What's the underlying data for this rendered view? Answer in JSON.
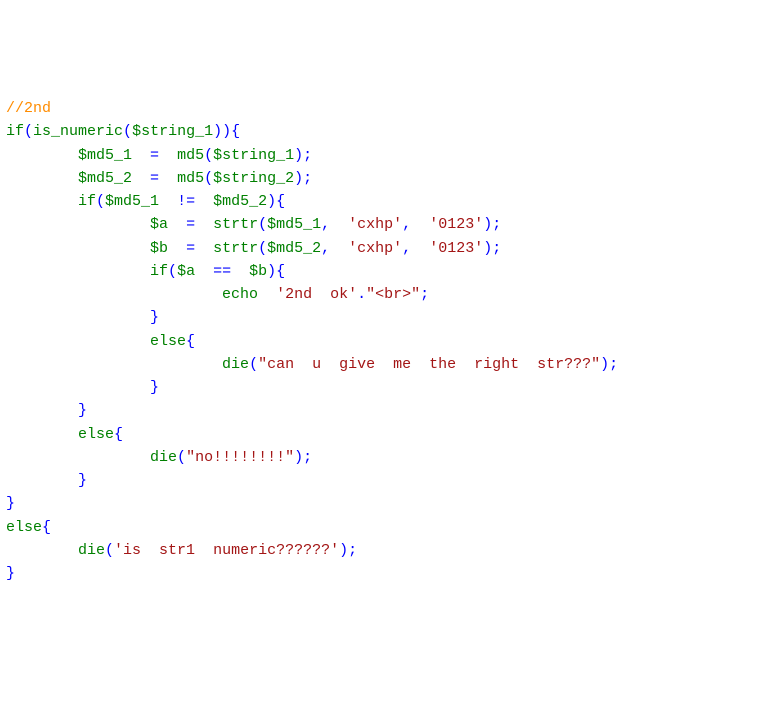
{
  "code": {
    "comment_2nd": "//2nd",
    "kw_if": "if",
    "fn_is_numeric": "is_numeric",
    "var_string_1": "$string_1",
    "var_string_2": "$string_2",
    "var_md5_1": "$md5_1",
    "var_md5_2": "$md5_2",
    "fn_md5": "md5",
    "op_assign": "=",
    "op_neq": "!=",
    "op_eq": "==",
    "var_a": "$a",
    "var_b": "$b",
    "fn_strtr": "strtr",
    "str_cxhp": "'cxhp'",
    "str_0123": "'0123'",
    "kw_echo": "echo",
    "str_2nd_ok": "'2nd  ok'",
    "op_concat": ".",
    "str_br": "\"<br>\"",
    "kw_else": "else",
    "fn_die": "die",
    "str_cant_give": "\"can  u  give  me  the  right  str???\"",
    "str_no": "\"no!!!!!!!!\"",
    "str_is_str1": "'is  str1  numeric??????'",
    "p_open": "(",
    "p_close": ")",
    "b_open": "{",
    "b_close": "}",
    "semi": ";",
    "comma": ","
  }
}
